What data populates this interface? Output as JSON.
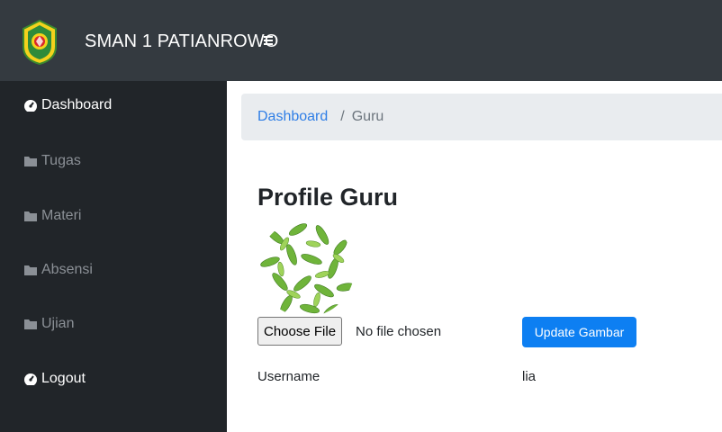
{
  "navbar": {
    "brand": "SMAN 1 PATIANROWO",
    "toggle_icon": "hamburger-menu-icon",
    "logo_icon": "school-emblem-logo"
  },
  "sidebar": {
    "items": [
      {
        "label": "Dashboard",
        "icon": "tachometer-icon",
        "active": true
      },
      {
        "label": "Tugas",
        "icon": "folder-icon",
        "active": false
      },
      {
        "label": "Materi",
        "icon": "folder-icon",
        "active": false
      },
      {
        "label": "Absensi",
        "icon": "folder-icon",
        "active": false
      },
      {
        "label": "Ujian",
        "icon": "folder-icon",
        "active": false
      },
      {
        "label": "Logout",
        "icon": "tachometer-icon",
        "active": true
      }
    ]
  },
  "breadcrumb": {
    "home": "Dashboard",
    "separator": "/",
    "current": "Guru"
  },
  "profile": {
    "title": "Profile Guru",
    "avatar_icon": "leaf-pattern-avatar",
    "file_button": "Choose File",
    "file_status": "No file chosen",
    "update_button": "Update Gambar",
    "fields": [
      {
        "label": "Username",
        "value": "lia"
      }
    ]
  },
  "colors": {
    "navbar": "#343a40",
    "sidebar": "#212529",
    "accent": "#0d7ff2",
    "link": "#2f7ee6",
    "breadcrumb_bg": "#e9ecef"
  }
}
